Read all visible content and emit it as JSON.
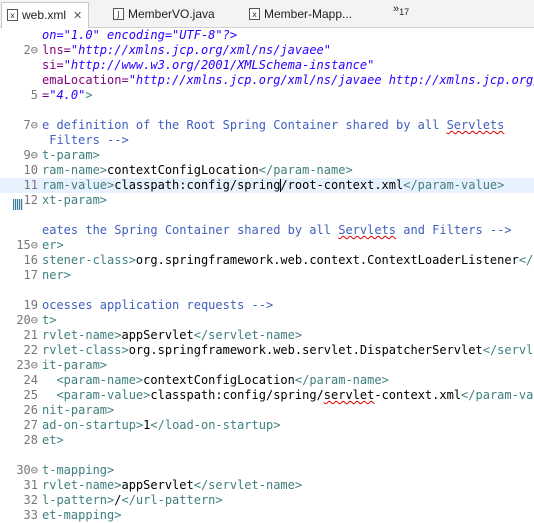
{
  "tabs": [
    {
      "label": "web.xml",
      "active": true,
      "icon": "xml-file-icon",
      "closable": true
    },
    {
      "label": "MemberVO.java",
      "active": false,
      "icon": "java-file-icon"
    },
    {
      "label": "Member-Mapp...",
      "active": false,
      "icon": "xml-file-icon"
    }
  ],
  "overflow": {
    "symbol": "»",
    "count": "17"
  },
  "editor": {
    "lines": [
      {
        "n": "",
        "fold": "",
        "segs": [
          [
            "str",
            "on=\"1.0\" encoding=\"UTF-8\"?>"
          ]
        ]
      },
      {
        "n": "2",
        "fold": "⊖",
        "segs": [
          [
            "at",
            "lns="
          ],
          [
            "str",
            "\"http://xmlns.jcp.org/xml/ns/javaee\""
          ]
        ]
      },
      {
        "n": "",
        "fold": "",
        "segs": [
          [
            "at",
            "si="
          ],
          [
            "str",
            "\"http://www.w3.org/2001/XMLSchema-instance\""
          ]
        ]
      },
      {
        "n": "",
        "fold": "",
        "segs": [
          [
            "at",
            "emaLocation="
          ],
          [
            "str",
            "\"http://xmlns.jcp.org/xml/ns/javaee http://xmlns.jcp.org/"
          ]
        ]
      },
      {
        "n": "5",
        "fold": "",
        "segs": [
          [
            "at",
            "="
          ],
          [
            "str",
            "\"4.0\""
          ],
          [
            "tg",
            ">"
          ]
        ]
      },
      {
        "n": "",
        "fold": "",
        "segs": []
      },
      {
        "n": "7",
        "fold": "⊖",
        "segs": [
          [
            "cm",
            "e definition of the Root Spring Container shared by all "
          ],
          [
            "cm sp",
            "Servlets"
          ]
        ]
      },
      {
        "n": "",
        "fold": "",
        "segs": [
          [
            "cm",
            " Filters -->"
          ]
        ]
      },
      {
        "n": "9",
        "fold": "⊖",
        "segs": [
          [
            "tg",
            "t-param>"
          ]
        ]
      },
      {
        "n": "10",
        "fold": "",
        "segs": [
          [
            "tg",
            "ram-name>"
          ],
          [
            "tx",
            "contextConfigLocation"
          ],
          [
            "tg",
            "</param-name>"
          ]
        ]
      },
      {
        "n": "11",
        "fold": "",
        "current": true,
        "segs": [
          [
            "tg",
            "ram-value>"
          ],
          [
            "tx",
            "classpath:config/spring/root-context.xml"
          ],
          [
            "tg",
            "</param-value>"
          ]
        ]
      },
      {
        "n": "12",
        "fold": "",
        "segs": [
          [
            "tg",
            "xt-param>"
          ]
        ]
      },
      {
        "n": "",
        "fold": "",
        "segs": []
      },
      {
        "n": "",
        "fold": "",
        "segs": [
          [
            "cm",
            "eates the Spring Container shared by all "
          ],
          [
            "cm sp",
            "Servlets"
          ],
          [
            "cm",
            " and Filters -->"
          ]
        ]
      },
      {
        "n": "15",
        "fold": "⊖",
        "segs": [
          [
            "tg",
            "er>"
          ]
        ]
      },
      {
        "n": "16",
        "fold": "",
        "segs": [
          [
            "tg",
            "stener-class>"
          ],
          [
            "tx",
            "org.springframework.web.context.ContextLoaderListener"
          ],
          [
            "tg",
            "</l"
          ]
        ]
      },
      {
        "n": "17",
        "fold": "",
        "segs": [
          [
            "tg",
            "ner>"
          ]
        ]
      },
      {
        "n": "",
        "fold": "",
        "segs": []
      },
      {
        "n": "19",
        "fold": "",
        "segs": [
          [
            "cm",
            "ocesses application requests -->"
          ]
        ]
      },
      {
        "n": "20",
        "fold": "⊖",
        "segs": [
          [
            "tg",
            "t>"
          ]
        ]
      },
      {
        "n": "21",
        "fold": "",
        "segs": [
          [
            "tg",
            "rvlet-name>"
          ],
          [
            "tx",
            "appServlet"
          ],
          [
            "tg",
            "</servlet-name>"
          ]
        ]
      },
      {
        "n": "22",
        "fold": "",
        "segs": [
          [
            "tg",
            "rvlet-class>"
          ],
          [
            "tx",
            "org.springframework.web.servlet.DispatcherServlet"
          ],
          [
            "tg",
            "</servle"
          ]
        ]
      },
      {
        "n": "23",
        "fold": "⊖",
        "segs": [
          [
            "tg",
            "it-param>"
          ]
        ]
      },
      {
        "n": "24",
        "fold": "",
        "segs": [
          [
            "tg",
            "  <param-name>"
          ],
          [
            "tx",
            "contextConfigLocation"
          ],
          [
            "tg",
            "</param-name>"
          ]
        ]
      },
      {
        "n": "25",
        "fold": "",
        "segs": [
          [
            "tg",
            "  <param-value>"
          ],
          [
            "tx",
            "classpath:config/spring/"
          ],
          [
            "tx sp",
            "servlet"
          ],
          [
            "tx",
            "-context.xml"
          ],
          [
            "tg",
            "</param-valu"
          ]
        ]
      },
      {
        "n": "26",
        "fold": "",
        "segs": [
          [
            "tg",
            "nit-param>"
          ]
        ]
      },
      {
        "n": "27",
        "fold": "",
        "segs": [
          [
            "tg",
            "ad-on-startup>"
          ],
          [
            "tx",
            "1"
          ],
          [
            "tg",
            "</load-on-startup>"
          ]
        ]
      },
      {
        "n": "28",
        "fold": "",
        "segs": [
          [
            "tg",
            "et>"
          ]
        ]
      },
      {
        "n": "",
        "fold": "",
        "segs": []
      },
      {
        "n": "30",
        "fold": "⊖",
        "segs": [
          [
            "tg",
            "t-mapping>"
          ]
        ]
      },
      {
        "n": "31",
        "fold": "",
        "segs": [
          [
            "tg",
            "rvlet-name>"
          ],
          [
            "tx",
            "appServlet"
          ],
          [
            "tg",
            "</servlet-name>"
          ]
        ]
      },
      {
        "n": "32",
        "fold": "",
        "segs": [
          [
            "tg",
            "l-pattern>"
          ],
          [
            "tx",
            "/"
          ],
          [
            "tg",
            "</url-pattern>"
          ]
        ]
      },
      {
        "n": "33",
        "fold": "",
        "segs": [
          [
            "tg",
            "et-mapping>"
          ]
        ]
      }
    ]
  }
}
